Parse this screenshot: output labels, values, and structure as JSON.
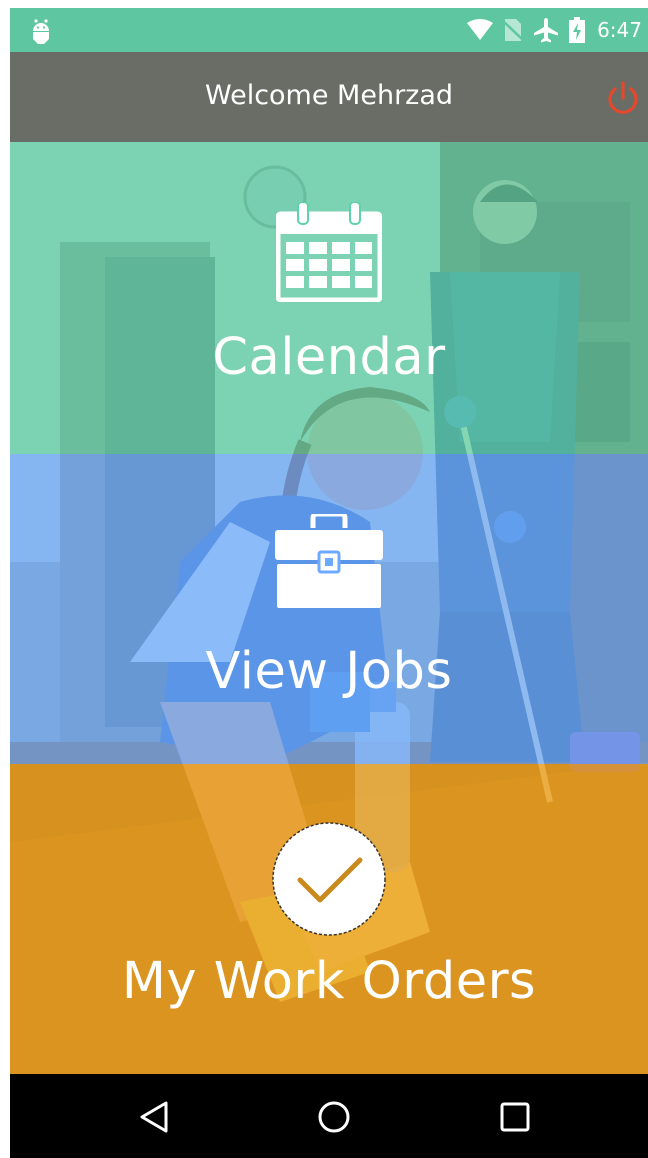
{
  "status_bar": {
    "time": "6:47",
    "icons": [
      "android-icon",
      "wifi-icon",
      "no-sim-icon",
      "airplane-icon",
      "battery-charging-icon"
    ],
    "background_color": "#5ec7a1"
  },
  "app_bar": {
    "title": "Welcome Mehrzad",
    "action_icon": "power-icon",
    "action_color": "#e5482c"
  },
  "menu": {
    "items": [
      {
        "label": "Calendar",
        "icon": "calendar-icon",
        "color": "#5ed2aa"
      },
      {
        "label": "View Jobs",
        "icon": "briefcase-icon",
        "color": "#6caaff"
      },
      {
        "label": "My Work Orders",
        "icon": "check-circle-icon",
        "color": "#eca01c"
      }
    ]
  },
  "nav_bar": {
    "buttons": [
      "back-icon",
      "home-icon",
      "recent-apps-icon"
    ]
  }
}
